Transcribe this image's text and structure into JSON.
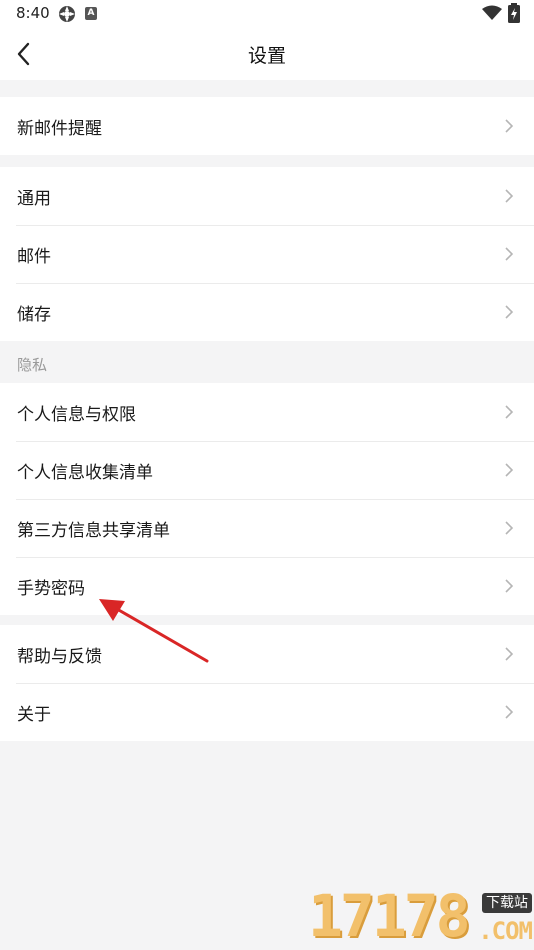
{
  "status_bar": {
    "time": "8:40"
  },
  "header": {
    "title": "设置"
  },
  "groups": [
    {
      "items": [
        {
          "label": "新邮件提醒"
        }
      ]
    },
    {
      "items": [
        {
          "label": "通用"
        },
        {
          "label": "邮件"
        },
        {
          "label": "储存"
        }
      ]
    },
    {
      "section_title": "隐私",
      "items": [
        {
          "label": "个人信息与权限"
        },
        {
          "label": "个人信息收集清单"
        },
        {
          "label": "第三方信息共享清单"
        },
        {
          "label": "手势密码"
        }
      ]
    },
    {
      "items": [
        {
          "label": "帮助与反馈"
        },
        {
          "label": "关于"
        }
      ]
    }
  ],
  "watermark": {
    "number": "17178",
    "badge": "下载站",
    "suffix": ".COM"
  },
  "colors": {
    "background": "#f4f4f5",
    "annotation_arrow": "#d92626"
  }
}
